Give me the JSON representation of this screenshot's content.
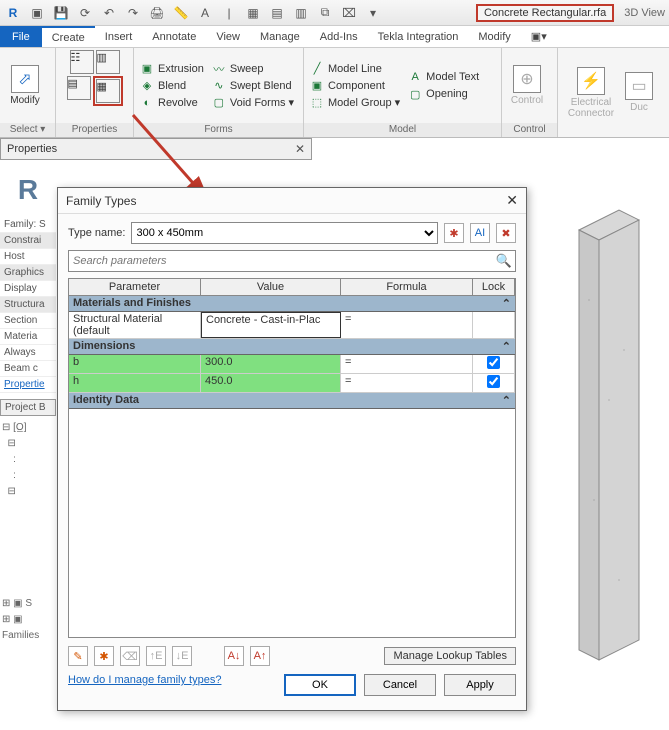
{
  "qat": {
    "filename": "Concrete Rectangular.rfa",
    "trail": "3D View"
  },
  "tabs": {
    "file": "File",
    "list": [
      "Create",
      "Insert",
      "Annotate",
      "View",
      "Manage",
      "Add-Ins",
      "Tekla Integration",
      "Modify"
    ],
    "active": 0
  },
  "ribbon": {
    "select": {
      "big": "Modify",
      "label": "Select ▾"
    },
    "properties": {
      "label": "Properties"
    },
    "forms": {
      "items": [
        "Extrusion",
        "Blend",
        "Revolve",
        "Sweep",
        "Swept Blend",
        "Void Forms ▾"
      ],
      "label": "Forms"
    },
    "model": {
      "row1": [
        "Model Line",
        "Model Text"
      ],
      "row2": [
        "Component",
        "Opening"
      ],
      "row3": [
        "Model Group ▾"
      ],
      "label": "Model"
    },
    "control": {
      "big": "Control",
      "label": "Control"
    },
    "elec": {
      "big": "Electrical Connector",
      "duct": "Duc"
    }
  },
  "props": {
    "title": "Properties"
  },
  "leftpanel": {
    "family": "Family: S",
    "rows": [
      "Constrai",
      "Host",
      "Graphics",
      "Display",
      "Structura",
      "Section",
      "Materia",
      "Always",
      "Beam c"
    ],
    "link": "Propertie",
    "pb": "Project B",
    "families": "Families"
  },
  "dialog": {
    "title": "Family Types",
    "typename_label": "Type name:",
    "typename_value": "300 x 450mm",
    "search_placeholder": "Search parameters",
    "columns": {
      "p": "Parameter",
      "v": "Value",
      "f": "Formula",
      "l": "Lock"
    },
    "groups": {
      "mat": "Materials and Finishes",
      "dim": "Dimensions",
      "id": "Identity Data"
    },
    "rows": {
      "structmat": {
        "p": "Structural Material (default",
        "v": "Concrete - Cast-in-Plac",
        "f": "="
      },
      "b": {
        "p": "b",
        "v": "300.0",
        "f": "="
      },
      "h": {
        "p": "h",
        "v": "450.0",
        "f": "="
      }
    },
    "mlt": "Manage Lookup Tables",
    "help": "How do I manage family types?",
    "ok": "OK",
    "cancel": "Cancel",
    "apply": "Apply"
  },
  "chart_data": {
    "type": "table",
    "title": "Family Types — 300 x 450mm",
    "columns": [
      "Parameter",
      "Value",
      "Formula",
      "Lock"
    ],
    "rows": [
      [
        "Structural Material (default)",
        "Concrete - Cast-in-Place",
        "=",
        ""
      ],
      [
        "b",
        "300.0",
        "=",
        true
      ],
      [
        "h",
        "450.0",
        "=",
        true
      ]
    ]
  }
}
